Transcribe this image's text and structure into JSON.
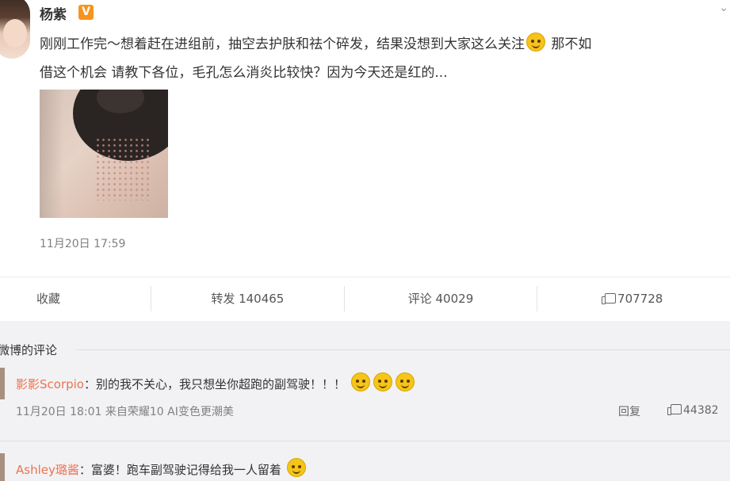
{
  "post": {
    "username": "杨紫",
    "verified_badge": "V",
    "top_right_icon": "chevron-down-icon",
    "text_line1": "刚刚工作完～想着赶在进组前，抽空去护肤和祛个碎发，结果没想到大家这么关注",
    "text_line1_after": " 那不如",
    "text_line2": "借这个机会 请教下各位，毛孔怎么消炎比较快？因为今天还是红的...",
    "time": "11月20日 17:59"
  },
  "actions": {
    "favorite": "收藏",
    "repost": "转发 140465",
    "comment": "评论 40029",
    "like": "707728"
  },
  "comments": {
    "section_title": "微博的评论",
    "items": [
      {
        "name": "影影Scorpio",
        "sep": "：",
        "text": "别的我不关心，我只想坐你超跑的副驾驶！！！",
        "meta": "11月20日 18:01 来自荣耀10 AI变色更潮美",
        "reply": "回复",
        "likes": "44382"
      },
      {
        "name": "Ashley璐酱",
        "sep": "：",
        "text": "富婆！跑车副驾驶记得给我一人留着"
      }
    ]
  },
  "colors": {
    "link": "#eb7350",
    "badge": "#f7941d",
    "muted": "#808080"
  }
}
